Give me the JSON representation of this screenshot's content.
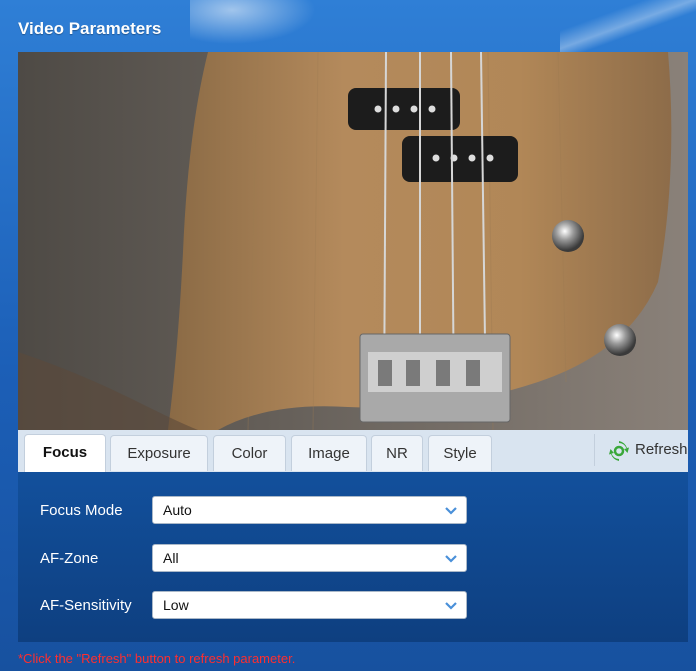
{
  "window": {
    "title": "Video Parameters"
  },
  "tabs": [
    {
      "label": "Focus",
      "active": true
    },
    {
      "label": "Exposure",
      "active": false
    },
    {
      "label": "Color",
      "active": false
    },
    {
      "label": "Image",
      "active": false
    },
    {
      "label": "NR",
      "active": false
    },
    {
      "label": "Style",
      "active": false
    }
  ],
  "refresh": {
    "label": "Refresh",
    "icon": "refresh-icon",
    "color": "#3aa83a"
  },
  "focus_settings": {
    "focus_mode": {
      "label": "Focus Mode",
      "value": "Auto"
    },
    "af_zone": {
      "label": "AF-Zone",
      "value": "All"
    },
    "af_sensitivity": {
      "label": "AF-Sensitivity",
      "value": "Low"
    }
  },
  "note": "*Click the \"Refresh\" button to refresh parameter.",
  "colors": {
    "accent": "#1c5fb7",
    "note": "#ff2e2e",
    "panel": "#0e3f80"
  }
}
